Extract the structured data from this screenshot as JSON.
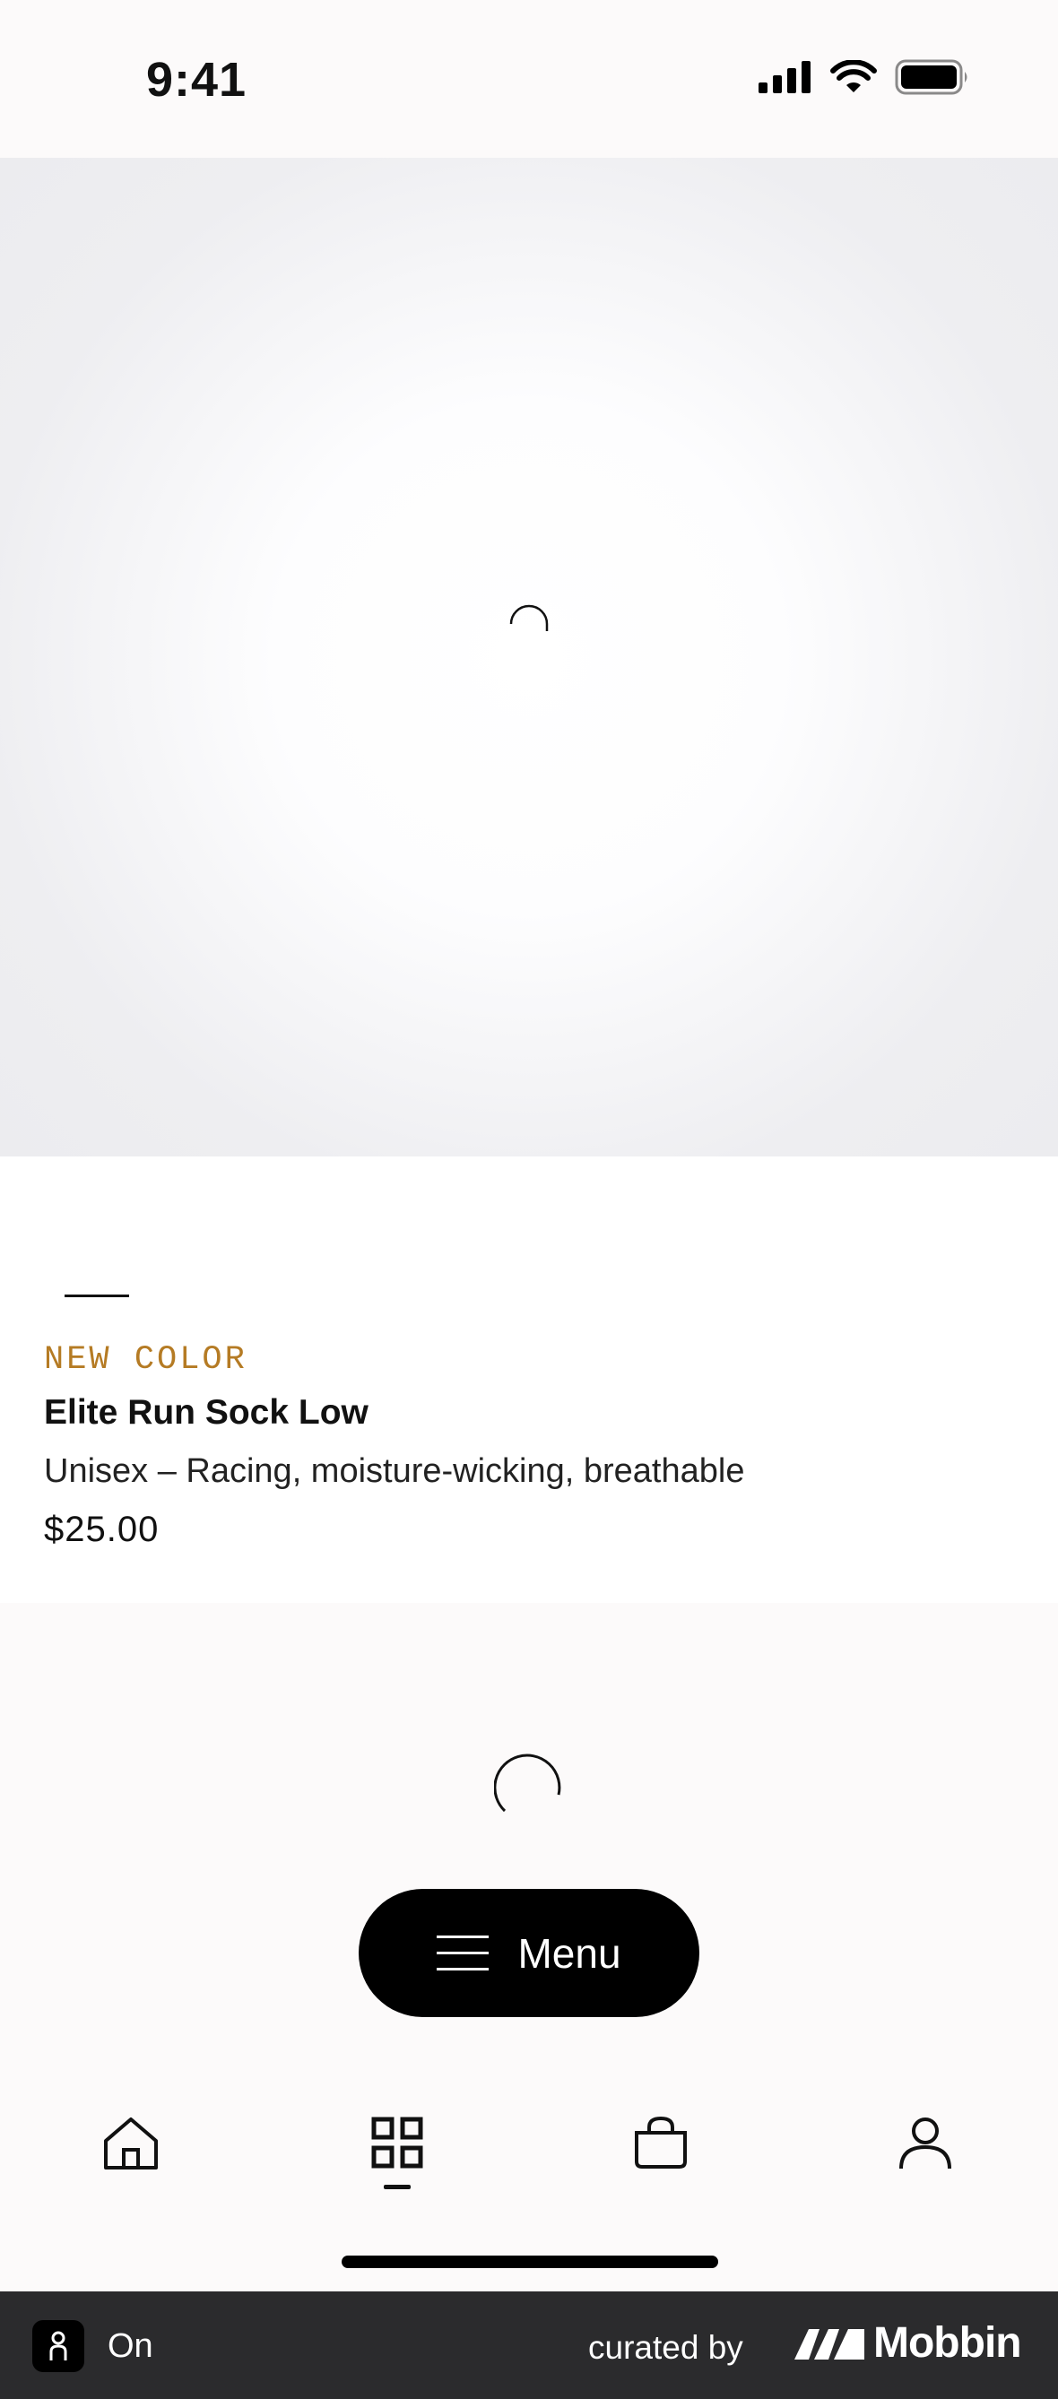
{
  "status_bar": {
    "time": "9:41"
  },
  "product": {
    "badge": "NEW COLOR",
    "name": "Elite Run Sock Low",
    "description": "Unisex – Racing, moisture-wicking, breathable",
    "price": "$25.00"
  },
  "menu_button": {
    "label": "Menu",
    "icon": "hamburger-icon"
  },
  "tab_bar": {
    "tabs": [
      {
        "icon": "home-icon",
        "selected": false
      },
      {
        "icon": "grid-icon",
        "selected": true
      },
      {
        "icon": "bag-icon",
        "selected": false
      },
      {
        "icon": "profile-icon",
        "selected": false
      }
    ]
  },
  "footer": {
    "app_name": "On",
    "curated_by": "curated by",
    "brand": "Mobbin"
  }
}
